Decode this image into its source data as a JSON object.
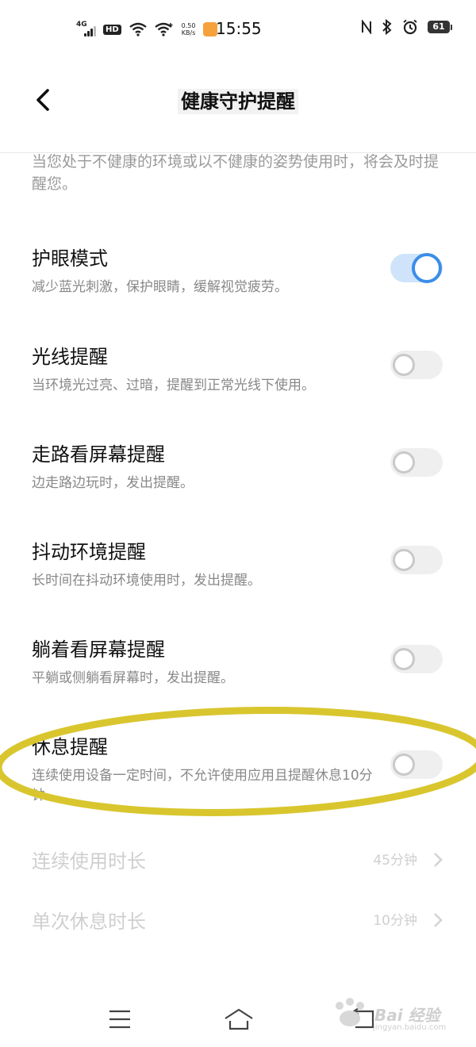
{
  "status_bar": {
    "network": "4G",
    "hd": "HD",
    "speed_value": "0.50",
    "speed_unit": "KB/s",
    "time": "15:55",
    "battery": "61",
    "icons": [
      "signal-icon",
      "wifi-icon",
      "nfc-icon",
      "bluetooth-icon",
      "alarm-icon",
      "battery-icon"
    ]
  },
  "header": {
    "title": "健康守护提醒",
    "back_icon": "chevron-left-icon"
  },
  "intro": "当您处于不健康的环境或以不健康的姿势使用时，将会及时提醒您。",
  "settings": [
    {
      "title": "护眼模式",
      "desc": "减少蓝光刺激，保护眼睛，缓解视觉疲劳。",
      "enabled": true
    },
    {
      "title": "光线提醒",
      "desc": "当环境光过亮、过暗，提醒到正常光线下使用。",
      "enabled": false
    },
    {
      "title": "走路看屏幕提醒",
      "desc": "边走路边玩时，发出提醒。",
      "enabled": false
    },
    {
      "title": "抖动环境提醒",
      "desc": "长时间在抖动环境使用时，发出提醒。",
      "enabled": false
    },
    {
      "title": "躺着看屏幕提醒",
      "desc": "平躺或侧躺看屏幕时，发出提醒。",
      "enabled": false
    },
    {
      "title": "休息提醒",
      "desc": "连续使用设备一定时间，不允许使用应用且提醒休息10分钟。",
      "enabled": false
    }
  ],
  "durations": [
    {
      "label": "连续使用时长",
      "value": "45分钟"
    },
    {
      "label": "单次休息时长",
      "value": "10分钟"
    }
  ],
  "colors": {
    "accent": "#3b8de8",
    "highlight": "#d9c62e"
  },
  "watermark": {
    "text": "Bai 经验",
    "url": "jingyan.baidu.com"
  }
}
